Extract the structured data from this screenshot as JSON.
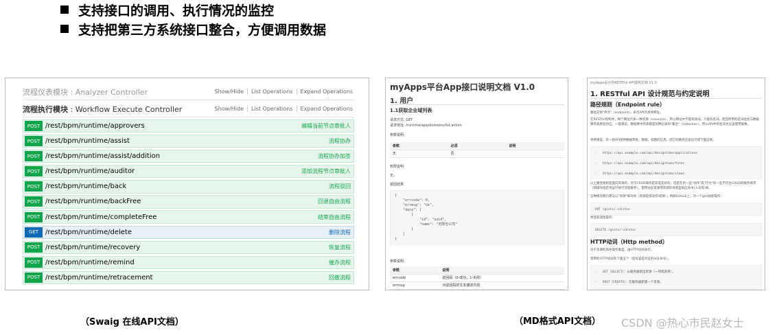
{
  "bullets": [
    "支持接口的调用、执行情况的监控",
    "支持把第三方系统接口整合，方便调用数据"
  ],
  "swagger": {
    "controller1_title": "流程仪表模块",
    "controller1_sub": " : Analyzer Controller",
    "controller2_title": "流程执行模块",
    "controller2_sub": " : Workflow Execute Controller",
    "actions": [
      "Show/Hide",
      "List Operations",
      "Expand Operations"
    ],
    "operations": [
      {
        "method": "POST",
        "path": "/rest/bpm/runtime/approvers",
        "summary": "编辑当前节点审批人"
      },
      {
        "method": "POST",
        "path": "/rest/bpm/runtime/assist",
        "summary": "流程协办"
      },
      {
        "method": "POST",
        "path": "/rest/bpm/runtime/assist/addition",
        "summary": "流程协办加签"
      },
      {
        "method": "POST",
        "path": "/rest/bpm/runtime/auditor",
        "summary": "添加流程节点审批人"
      },
      {
        "method": "POST",
        "path": "/rest/bpm/runtime/back",
        "summary": "流程驳回"
      },
      {
        "method": "POST",
        "path": "/rest/bpm/runtime/backFree",
        "summary": "回退自由流程"
      },
      {
        "method": "POST",
        "path": "/rest/bpm/runtime/completeFree",
        "summary": "结束自由流程"
      },
      {
        "method": "GET",
        "path": "/rest/bpm/runtime/delete",
        "summary": "删除流程"
      },
      {
        "method": "POST",
        "path": "/rest/bpm/runtime/recovery",
        "summary": "恢复流程"
      },
      {
        "method": "POST",
        "path": "/rest/bpm/runtime/remind",
        "summary": "催办流程"
      },
      {
        "method": "POST",
        "path": "/rest/bpm/runtime/retracement",
        "summary": "回撤流程"
      }
    ],
    "caption": "（Swaig 在线API文档）"
  },
  "md_doc": {
    "title": "myApps平台App接口说明文档 V1.0",
    "section": "1.  用户",
    "subsection": "1.1获取企业域列表",
    "request_method": "请求方式:   GET",
    "request_url": "请求地址:   /runtime/app/domains/list.action",
    "params_label": "参数说明:",
    "param_headers": [
      "参数",
      "必须",
      "说明"
    ],
    "param_row": [
      "无",
      "否",
      ""
    ],
    "return_label": "权限说明:",
    "return_value": "无。",
    "result_label": "返回结果:",
    "result_code": "{\n    \"errcode\": 0,\n    \"errmsg\": \"ok\",\n    \"data\": [\n        {\n            \"id\": \"uuid\",\n            \"name\": \"无限也公司\"\n        }\n    ]\n}",
    "result_params_label": "参数说明:",
    "result_headers": [
      "参数",
      "说明"
    ],
    "result_rows": [
      [
        "errcode",
        "返回码（0-成功，1-失败）"
      ],
      [
        "errmsg",
        "对返回码的文本描述内容"
      ]
    ],
    "caption": "（MD格式API文档）"
  },
  "rest_doc": {
    "top": "myApps设计所RESTful API说明文档 V1.0",
    "title": "1.  RESTful API 设计规范与约定说明",
    "h_endpoint": "路径规则（Endpoint rule）",
    "p1": "路径又称\"终点\"（endpoint），表示API的具体网址。",
    "p2": "在RESTful架构中，每个网址代表一种资源（resource），所以网址中不能有动词，只能有名词，而且所用的名词往往与数据库的表格名对应。一般来说，数据库中的表都是同种记录的\"集合\"（collection），所以API中的名词也应该使用复数。",
    "p3": "举例来说，有一组API提供数据审批，数据，视图的信息，则它的路径应该设计成下面这样。",
    "code1": "-   https://api.example.com/api/designtime/applications\n-   https://api.example.com/api/designtime/forms\n-   https://api.example.com/api/designtime/views",
    "p4": "以上路径规则是面向资源的，对于CRUD操作是非常友好的，但是在另一些\"动作\"或\"行为\"的一些不符合CRUD的服务请求（如操作指定到运行依行流程服务），使用动态资源或资源的场景型响应命令(人员等)来。",
    "p5": "这种情况我们建议以\"资源\"来对待（资源是指动作/结果），例如GitHub上，对一个gist加星操作：",
    "code2": "PUT /gists/:id/star",
    "p6": "并且取消星操作：",
    "code3": "DELETE /gists/:id/star",
    "h_http": "HTTP动词（Http method）",
    "p7": "对于资源的具体操作类型，由HTTP动词表示。",
    "p8": "常用的HTTP动词有下面五个（括号里是对应的SQL命令）。",
    "code4": "-   GET（SELECT）：从服务器取出资源（一项或多项）。\n-   POST（CREATE）：在服务器新建一个资源。"
  },
  "watermark": "CSDN @热心市民赵女士"
}
